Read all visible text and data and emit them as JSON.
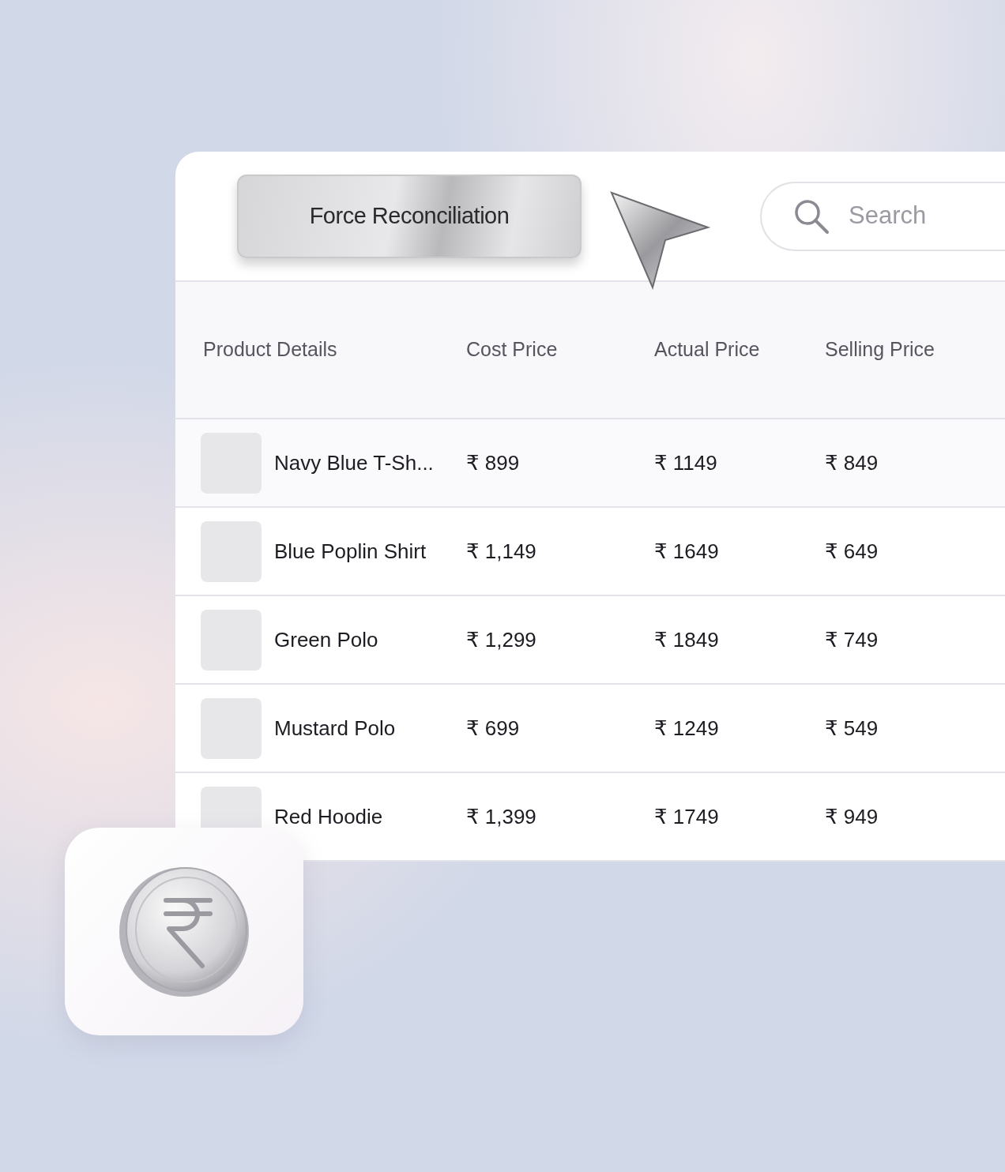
{
  "toolbar": {
    "button": "Force Reconciliation",
    "search": {
      "placeholder": "Search"
    }
  },
  "table": {
    "columns": [
      "Product Details",
      "Cost Price",
      "Actual Price",
      "Selling Price"
    ],
    "rows": [
      {
        "product": "Navy Blue T-Sh...",
        "cost": "₹ 899",
        "actual": "₹ 1149",
        "selling": "₹ 849"
      },
      {
        "product": "Blue Poplin Shirt",
        "cost": "₹ 1,149",
        "actual": "₹ 1649",
        "selling": "₹ 649"
      },
      {
        "product": "Green Polo",
        "cost": "₹ 1,299",
        "actual": "₹ 1849",
        "selling": "₹ 749"
      },
      {
        "product": "Mustard Polo",
        "cost": "₹ 699",
        "actual": "₹ 1249",
        "selling": "₹ 549"
      },
      {
        "product": "Red Hoodie",
        "cost": "₹ 1,399",
        "actual": "₹ 1749",
        "selling": "₹ 949"
      }
    ]
  }
}
